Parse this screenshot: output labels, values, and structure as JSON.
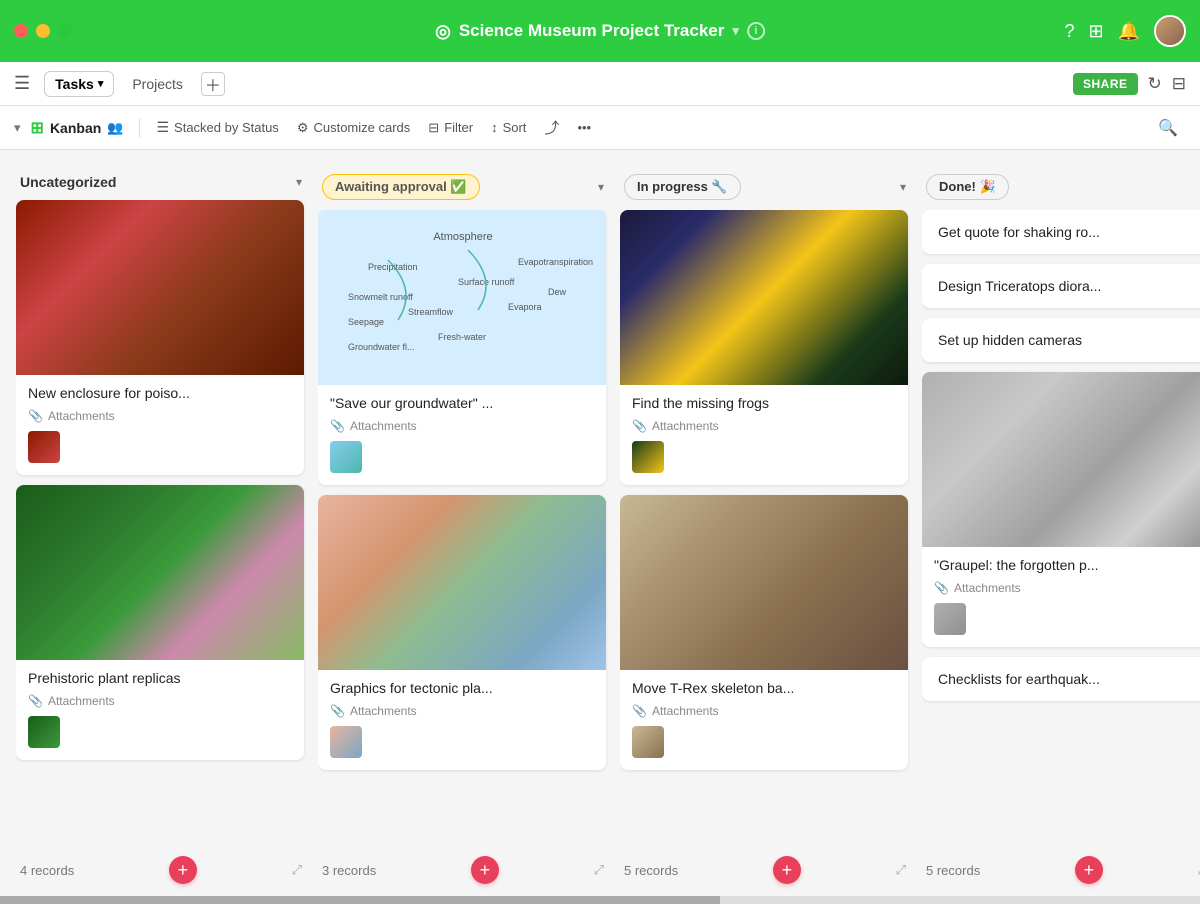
{
  "app": {
    "title": "Science Museum Project Tracker",
    "logo_icon": "◎"
  },
  "window_controls": {
    "close": "●",
    "minimize": "●",
    "maximize": "●"
  },
  "toolbar": {
    "menu_icon": "☰",
    "tasks_label": "Tasks",
    "projects_label": "Projects",
    "share_label": "SHARE"
  },
  "view_bar": {
    "view_type": "Kanban",
    "stacked_by": "Stacked by Status",
    "customize": "Customize cards",
    "filter": "Filter",
    "sort": "Sort"
  },
  "columns": [
    {
      "id": "uncategorized",
      "title": "Uncategorized",
      "badge_type": "plain",
      "records_count": "4 records",
      "cards": [
        {
          "id": "card1",
          "has_image": true,
          "image_class": "frog-red",
          "title": "New enclosure for poiso...",
          "has_attachments": true,
          "thumb_class": "thumb-frog"
        },
        {
          "id": "card2",
          "has_image": true,
          "image_class": "plant-green",
          "title": "Prehistoric plant replicas",
          "has_attachments": true,
          "thumb_class": "thumb-plant"
        }
      ]
    },
    {
      "id": "awaiting",
      "title": "Awaiting approval ✅",
      "badge_type": "awaiting",
      "records_count": "3 records",
      "cards": [
        {
          "id": "card3",
          "has_image": true,
          "image_class": "water-cycle",
          "title": "\"Save our groundwater\" ...",
          "has_attachments": true,
          "thumb_class": "thumb-water"
        },
        {
          "id": "card4",
          "has_image": true,
          "image_class": "tectonic",
          "title": "Graphics for tectonic pla...",
          "has_attachments": true,
          "thumb_class": "thumb-tectonic"
        }
      ]
    },
    {
      "id": "inprogress",
      "title": "In progress 🔧",
      "badge_type": "inprogress",
      "records_count": "5 records",
      "cards": [
        {
          "id": "card5",
          "has_image": true,
          "image_class": "frog-yellow",
          "title": "Find the missing frogs",
          "has_attachments": true,
          "thumb_class": "thumb-frog2"
        },
        {
          "id": "card6",
          "has_image": true,
          "image_class": "trex",
          "title": "Move T-Rex skeleton ba...",
          "has_attachments": true,
          "thumb_class": "thumb-trex"
        }
      ]
    },
    {
      "id": "done",
      "title": "Done! 🎉",
      "badge_type": "done",
      "records_count": "5 records",
      "cards": [
        {
          "id": "card7",
          "has_image": false,
          "title": "Get quote for shaking ro...",
          "has_attachments": false
        },
        {
          "id": "card8",
          "has_image": false,
          "title": "Design Triceratops diora...",
          "has_attachments": false
        },
        {
          "id": "card9",
          "has_image": false,
          "title": "Set up hidden cameras",
          "has_attachments": false
        },
        {
          "id": "card10",
          "has_image": true,
          "image_class": "graupel",
          "title": "\"Graupel: the forgotten p...",
          "has_attachments": true,
          "thumb_class": "thumb-graupel"
        },
        {
          "id": "card11",
          "has_image": false,
          "title": "Checklists for earthquak...",
          "has_attachments": false
        }
      ]
    }
  ],
  "labels": {
    "attachments": "Attachments",
    "add_record": "+",
    "records_suffix": "records"
  }
}
